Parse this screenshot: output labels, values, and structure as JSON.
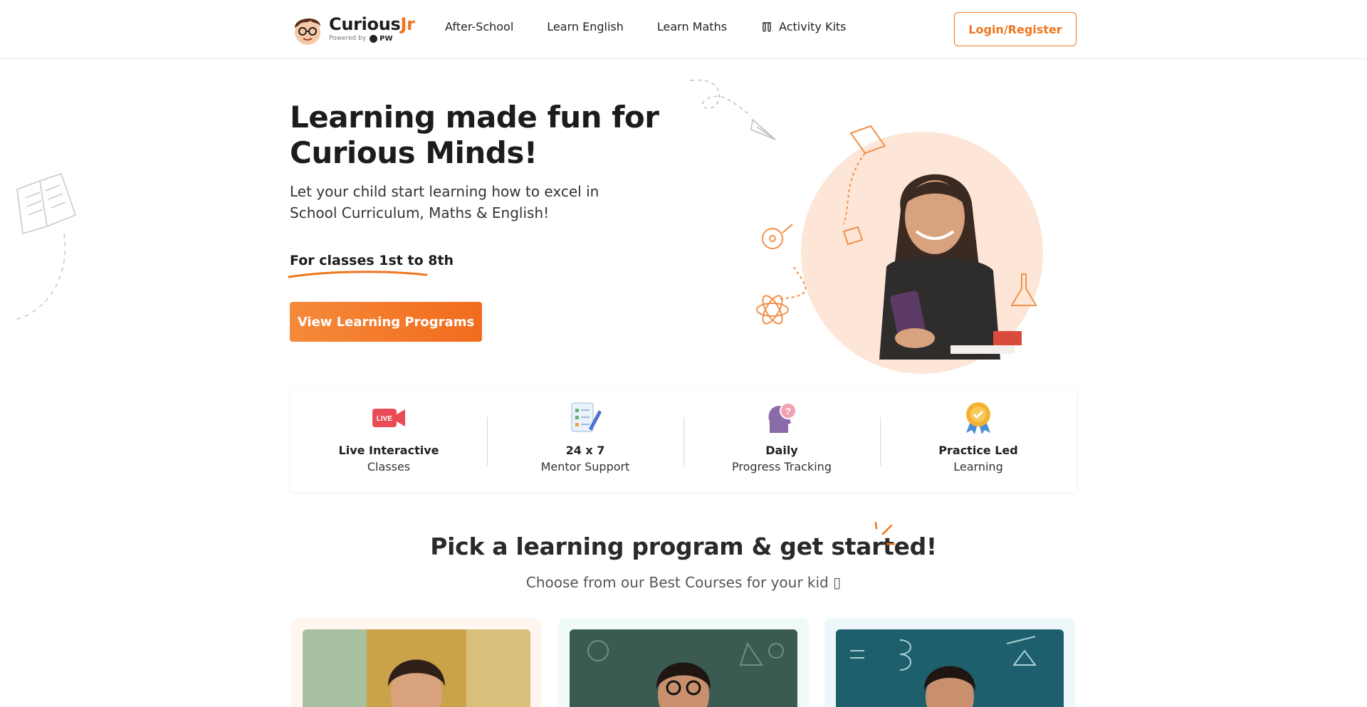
{
  "header": {
    "logo_brand": "Curious",
    "logo_brand_accent": "Jr",
    "logo_powered_by": "Powered by",
    "logo_partner": "PW",
    "nav": [
      {
        "label": "After-School"
      },
      {
        "label": "Learn English"
      },
      {
        "label": "Learn Maths"
      },
      {
        "label": "Activity Kits",
        "icon": "flask-kit-icon"
      }
    ],
    "login_label": "Login/Register"
  },
  "hero": {
    "title": "Learning made fun for Curious Minds!",
    "subtitle": "Let your child start learning how to excel in School Curriculum, Maths & English!",
    "classes": "For classes 1st to 8th",
    "cta_label": "View Learning Programs"
  },
  "features": [
    {
      "icon": "live-video-icon",
      "line1": "Live Interactive",
      "line2": "Classes"
    },
    {
      "icon": "checklist-pencil-icon",
      "line1": "24 x 7",
      "line2": "Mentor Support"
    },
    {
      "icon": "head-question-icon",
      "line1": "Daily",
      "line2": "Progress Tracking"
    },
    {
      "icon": "award-badge-icon",
      "line1": "Practice Led",
      "line2": "Learning"
    }
  ],
  "programs": {
    "title": "Pick a learning program & get started!",
    "subtitle": "Choose from our Best Courses for your kid ▯"
  },
  "colors": {
    "accent": "#f0761e",
    "cta_start": "#f58a3a",
    "cta_end": "#f26b1d",
    "hero_circle": "#fde6d8"
  }
}
